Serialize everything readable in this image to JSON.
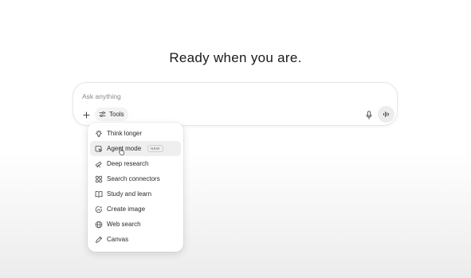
{
  "headline": "Ready when you are.",
  "composer": {
    "placeholder": "Ask anything",
    "tools_label": "Tools",
    "icons": {
      "add": "plus-icon",
      "tools": "sliders-icon",
      "dictate": "microphone-icon",
      "voice": "waveform-icon"
    }
  },
  "tools_menu": {
    "items": [
      {
        "label": "Think longer",
        "icon": "lightbulb-icon"
      },
      {
        "label": "Agent mode",
        "icon": "agent-icon",
        "badge": "NEW",
        "highlighted": true
      },
      {
        "label": "Deep research",
        "icon": "telescope-icon"
      },
      {
        "label": "Search connectors",
        "icon": "connectors-icon"
      },
      {
        "label": "Study and learn",
        "icon": "book-icon"
      },
      {
        "label": "Create image",
        "icon": "image-icon"
      },
      {
        "label": "Web search",
        "icon": "globe-icon"
      },
      {
        "label": "Canvas",
        "icon": "pen-icon"
      }
    ]
  },
  "colors": {
    "text": "#1f1f1f",
    "menu_highlight": "#efefef",
    "voice_button": "#ececec"
  }
}
